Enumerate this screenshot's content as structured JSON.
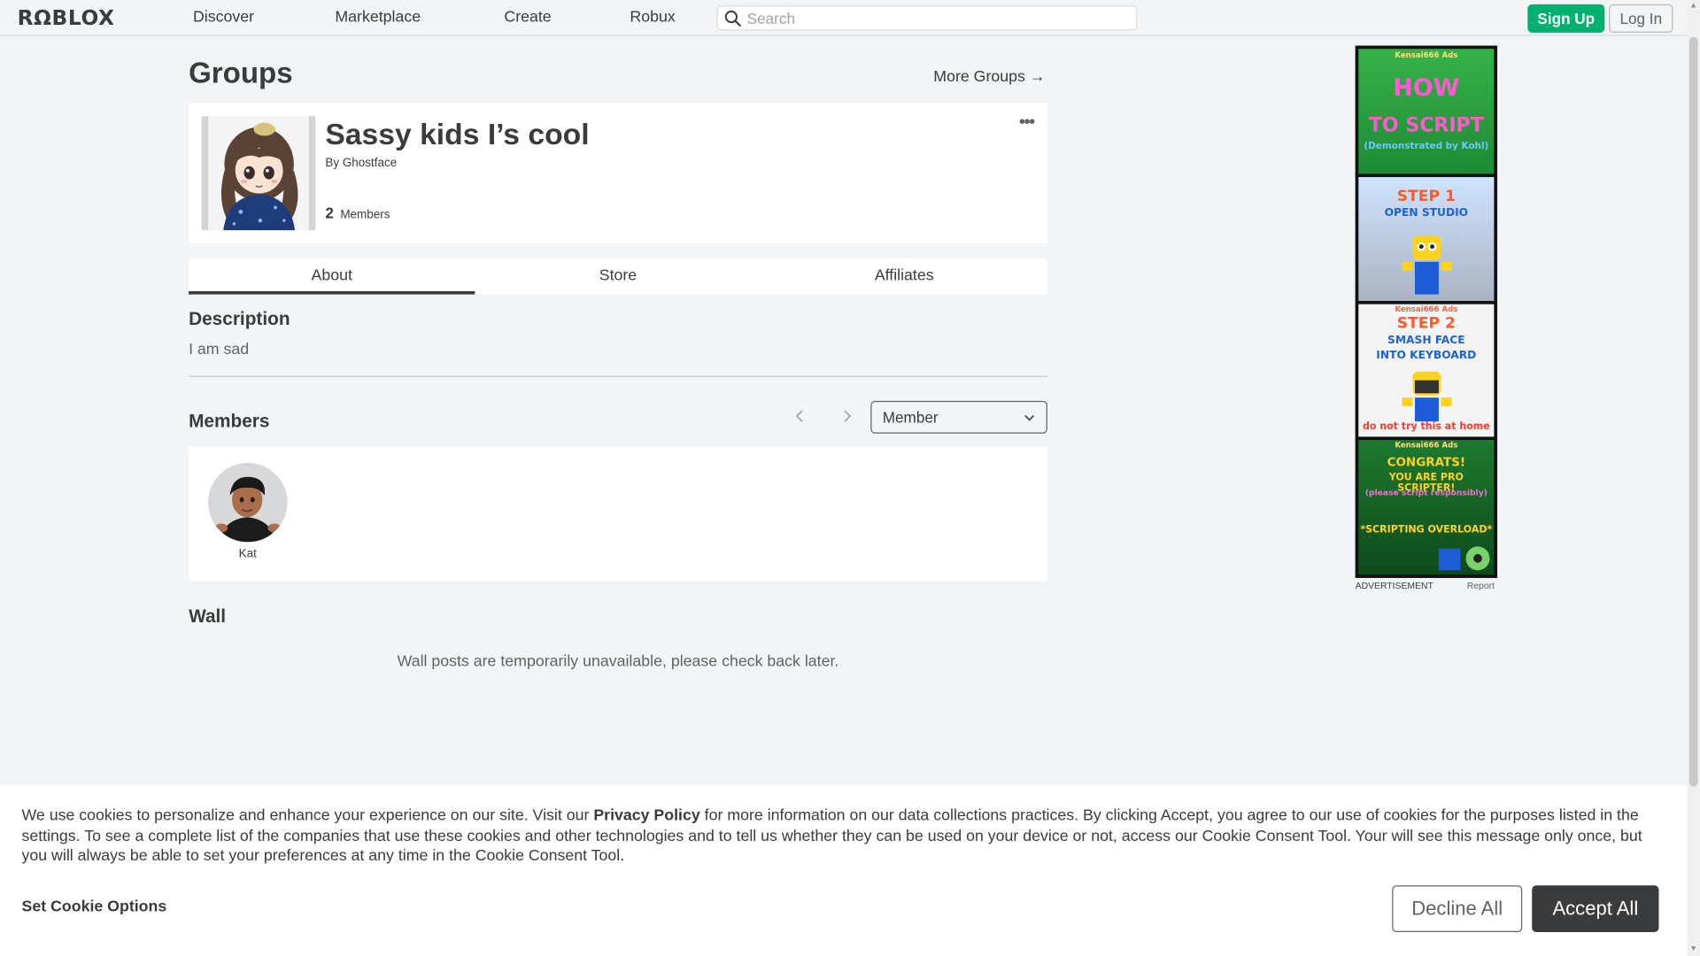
{
  "header": {
    "logo": "RΩBLOX",
    "nav": [
      "Discover",
      "Marketplace",
      "Create",
      "Robux"
    ],
    "search_placeholder": "Search",
    "signup_label": "Sign Up",
    "login_label": "Log In"
  },
  "page": {
    "title": "Groups",
    "more_groups": "More Groups →"
  },
  "group": {
    "name": "Sassy kids I’s cool",
    "by_prefix": "By",
    "owner": "Ghostface",
    "member_count": "2",
    "members_label": "Members",
    "more_icon": "•••"
  },
  "tabs": [
    "About",
    "Store",
    "Affiliates"
  ],
  "about": {
    "description_heading": "Description",
    "description": "I am sad",
    "members_heading": "Members",
    "role_selected": "Member",
    "members": [
      {
        "name": "Kat"
      }
    ],
    "wall_heading": "Wall",
    "wall_message": "Wall posts are temporarily unavailable, please check back later."
  },
  "ad": {
    "panels": [
      {
        "tag": "Kensai666 Ads",
        "lines": [
          "HOW",
          "TO SCRIPT",
          "(Demonstrated by Kohl)"
        ]
      },
      {
        "tag": "",
        "lines": [
          "STEP 1",
          "OPEN STUDIO"
        ]
      },
      {
        "tag": "Kensai666 Ads",
        "lines": [
          "STEP 2",
          "SMASH FACE",
          "INTO KEYBOARD",
          "do not try this at home"
        ]
      },
      {
        "tag": "Kensai666 Ads",
        "lines": [
          "CONGRATS!",
          "YOU ARE PRO SCRIPTER!",
          "(please script responsibly)",
          "*SCRIPTING OVERLOAD*"
        ]
      }
    ],
    "label": "ADVERTISEMENT",
    "report": "Report"
  },
  "cookie": {
    "text_before": "We use cookies to personalize and enhance your experience on our site. Visit our ",
    "privacy_link": "Privacy Policy",
    "text_after": " for more information on our data collections practices. By clicking Accept, you agree to our use of cookies for the purposes listed in the settings. To see a complete list of the companies that use these cookies and other technologies and to tell us whether they can be used on your device or not, access our Cookie Consent Tool. Your will see this message only once, but you will always be able to set your preferences at any time in the Cookie Consent Tool.",
    "options_label": "Set Cookie Options",
    "decline_label": "Decline All",
    "accept_label": "Accept All"
  },
  "colors": {
    "background": "#f2f4f5",
    "signup_green": "#00b06f",
    "text_dark": "#393b3d",
    "accept_button": "#393b3d"
  },
  "icons": [
    "search-icon",
    "arrow-right-icon",
    "more-dots-icon",
    "chevron-left-icon",
    "chevron-right-icon",
    "chevron-down-icon"
  ]
}
